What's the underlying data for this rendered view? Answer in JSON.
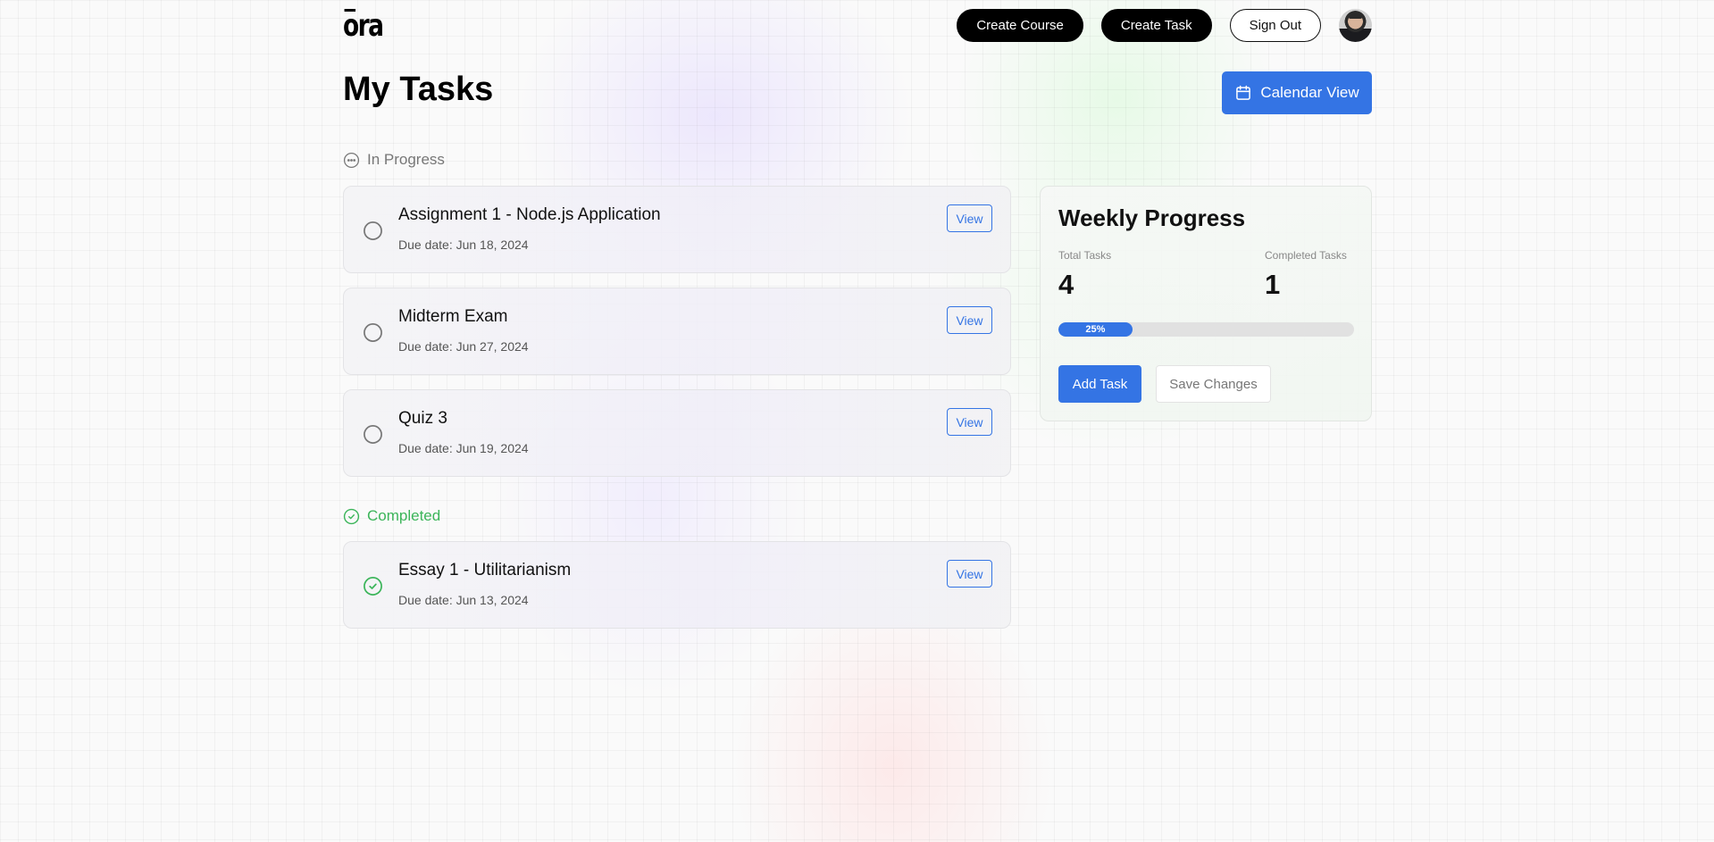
{
  "header": {
    "logo": "ora",
    "nav": {
      "create_course": "Create Course",
      "create_task": "Create Task",
      "sign_out": "Sign Out"
    },
    "avatar_alt": "user-avatar"
  },
  "main": {
    "title": "My Tasks",
    "calendar_button": "Calendar View",
    "sections": {
      "in_progress": {
        "label": "In Progress",
        "icon": "ellipsis-circle-icon",
        "tasks": [
          {
            "title": "Assignment 1 - Node.js Application",
            "due": "Due date: Jun 18, 2024",
            "action": "View",
            "status": "incomplete"
          },
          {
            "title": "Midterm Exam",
            "due": "Due date: Jun 27, 2024",
            "action": "View",
            "status": "incomplete"
          },
          {
            "title": "Quiz 3",
            "due": "Due date: Jun 19, 2024",
            "action": "View",
            "status": "incomplete"
          }
        ]
      },
      "completed": {
        "label": "Completed",
        "icon": "check-circle-icon",
        "tasks": [
          {
            "title": "Essay 1 - Utilitarianism",
            "due": "Due date: Jun 13, 2024",
            "action": "View",
            "status": "complete"
          }
        ]
      }
    }
  },
  "weekly_progress": {
    "title": "Weekly Progress",
    "total_label": "Total Tasks",
    "total_value": "4",
    "completed_label": "Completed Tasks",
    "completed_value": "1",
    "progress_percent": 25,
    "progress_text": "25%",
    "add_task": "Add Task",
    "save_changes": "Save Changes"
  },
  "colors": {
    "accent": "#3474e4",
    "success": "#3cb55a",
    "muted": "#777777"
  }
}
